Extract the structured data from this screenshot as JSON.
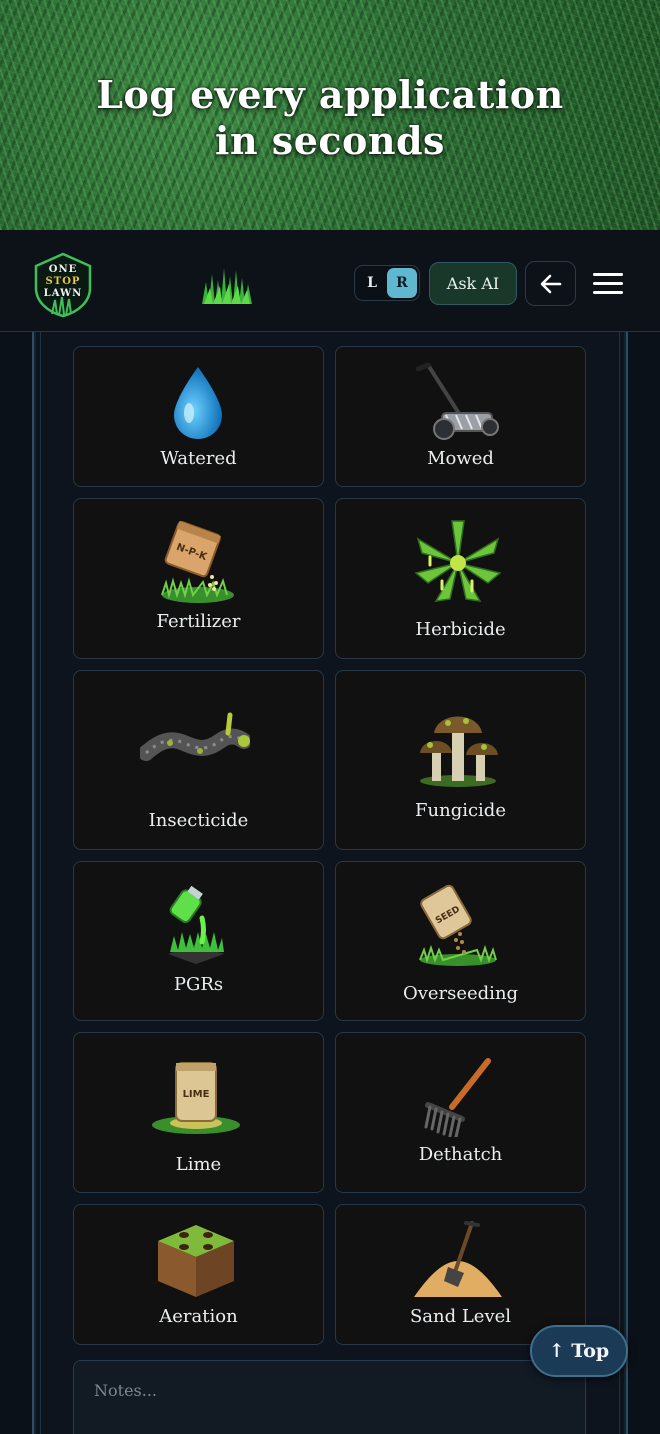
{
  "hero": {
    "title_line1": "Log every application",
    "title_line2": "in seconds"
  },
  "header": {
    "logo": {
      "line1": "ONE",
      "line2": "STOP",
      "line3": "LAWN"
    },
    "toggle": {
      "left_label": "L",
      "right_label": "R",
      "active": "R"
    },
    "ask_ai_label": "Ask AI",
    "back_icon": "arrow-left-icon",
    "menu_icon": "hamburger-menu-icon"
  },
  "tiles": [
    {
      "label": "Watered",
      "icon": "water-drop-icon"
    },
    {
      "label": "Mowed",
      "icon": "reel-mower-icon"
    },
    {
      "label": "Fertilizer",
      "icon": "fertilizer-bag-icon"
    },
    {
      "label": "Herbicide",
      "icon": "weed-plant-icon"
    },
    {
      "label": "Insecticide",
      "icon": "grub-insect-icon"
    },
    {
      "label": "Fungicide",
      "icon": "mushroom-cluster-icon"
    },
    {
      "label": "PGRs",
      "icon": "growth-regulator-bottle-icon"
    },
    {
      "label": "Overseeding",
      "icon": "seed-bag-icon"
    },
    {
      "label": "Lime",
      "icon": "lime-bag-icon"
    },
    {
      "label": "Dethatch",
      "icon": "rake-icon"
    },
    {
      "label": "Aeration",
      "icon": "soil-core-icon"
    },
    {
      "label": "Sand Level",
      "icon": "sand-pile-shovel-icon"
    }
  ],
  "bag_labels": {
    "fertilizer": "N-P-K",
    "seed": "SEED",
    "lime": "LIME"
  },
  "notes": {
    "placeholder": "Notes..."
  },
  "top_button_label": "↑ Top",
  "colors": {
    "background": "#0b1118",
    "tile_bg": "#111111",
    "tile_border": "#283846",
    "accent_blue": "#5fb8cf",
    "ask_ai_bg": "#193829",
    "logo_green": "#3fbf5a",
    "logo_gold": "#e8c44a"
  }
}
